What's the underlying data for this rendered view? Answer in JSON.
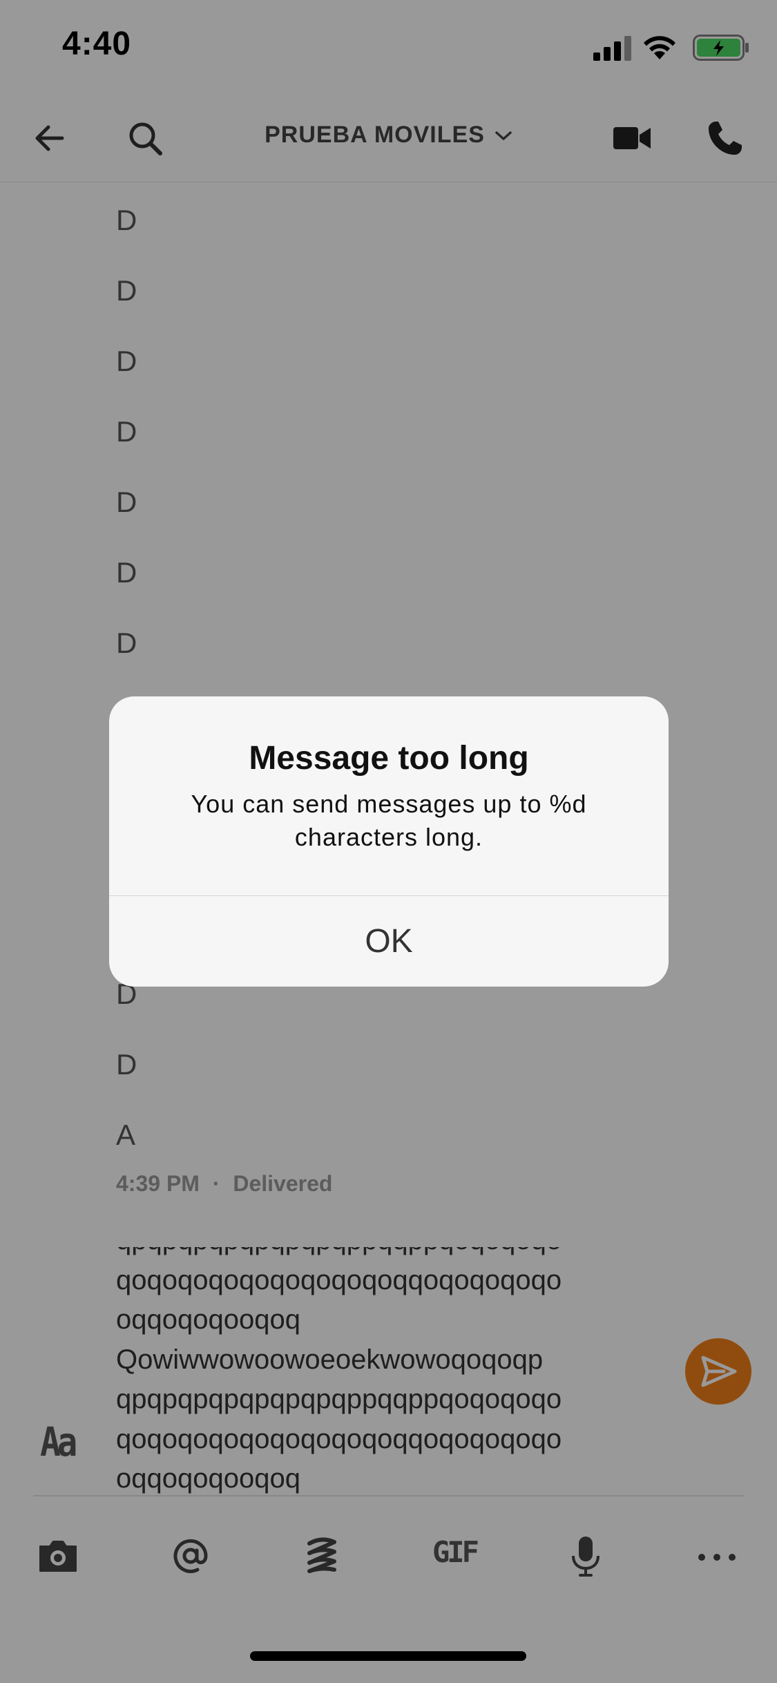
{
  "status_bar": {
    "time": "4:40"
  },
  "nav": {
    "title": "PRUEBA MOVILES",
    "icons": [
      "back-arrow-icon",
      "search-icon",
      "chevron-down-icon",
      "video-camera-icon",
      "phone-icon"
    ]
  },
  "messages": {
    "lines": [
      "D",
      "D",
      "D",
      "D",
      "D",
      "D",
      "D",
      "D",
      "D",
      "A"
    ],
    "timestamp": "4:39 PM",
    "separator": "·",
    "status": "Delivered"
  },
  "composer": {
    "text": "qpqpqpqpqpqpqpqppqqppqoqoqoqo\nqoqoqoqoqoqoqoqoqoqqoqoqoqoqo\noqqoqoqooqoq\nQowiwwowoowoeoekwowoqoqoqp\nqpqpqpqpqpqpqpqppqqppqoqoqoqo\nqoqoqoqoqoqoqoqoqoqqoqoqoqoqo\noqqoqoqooqoq",
    "format_label": "Aa",
    "send_color": "#f07f1a"
  },
  "toolbar": {
    "gif_label": "GIF",
    "icons": [
      "camera-icon",
      "at-mention-icon",
      "giphy-icon",
      "gif-icon",
      "microphone-icon",
      "more-icon"
    ]
  },
  "alert": {
    "title": "Message too long",
    "message": "You can send messages up to %d characters long.",
    "button": "OK"
  }
}
